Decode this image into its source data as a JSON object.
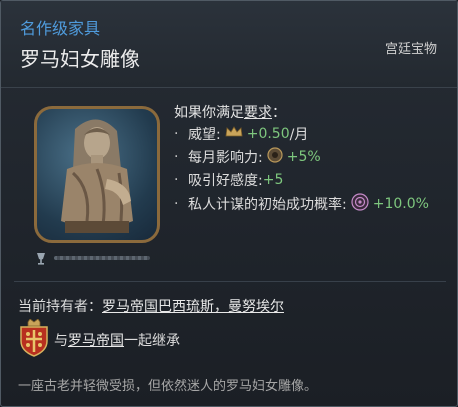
{
  "header": {
    "category": "名作级家具",
    "title": "罗马妇女雕像",
    "rarity": "宫廷宝物"
  },
  "requirements": {
    "title_prefix": "如果你满足",
    "title_link": "要求",
    "title_suffix": "：",
    "items": [
      {
        "label": "威望:",
        "icon": "crown-icon",
        "value": "+0.50",
        "suffix": "/月"
      },
      {
        "label": "每月影响力:",
        "icon": "influence-icon",
        "value": "+5%",
        "suffix": ""
      },
      {
        "label": "吸引好感度:",
        "icon": "",
        "value": "+5",
        "suffix": ""
      },
      {
        "label": "私人计谋的初始成功概率:",
        "icon": "scheme-icon",
        "value": "+10.0%",
        "suffix": ""
      }
    ],
    "bullet": "·"
  },
  "holder": {
    "label": "当前持有者：",
    "name": "罗马帝国巴西琉斯，曼努埃尔"
  },
  "inherit": {
    "prefix": "与",
    "realm": "罗马帝国",
    "suffix": "一起继承"
  },
  "description": "一座古老并轻微受损，但依然迷人的罗马妇女雕像。",
  "colors": {
    "category": "#4f9bdc",
    "positive": "#7ec77e",
    "frame": "#8b6a3c"
  }
}
